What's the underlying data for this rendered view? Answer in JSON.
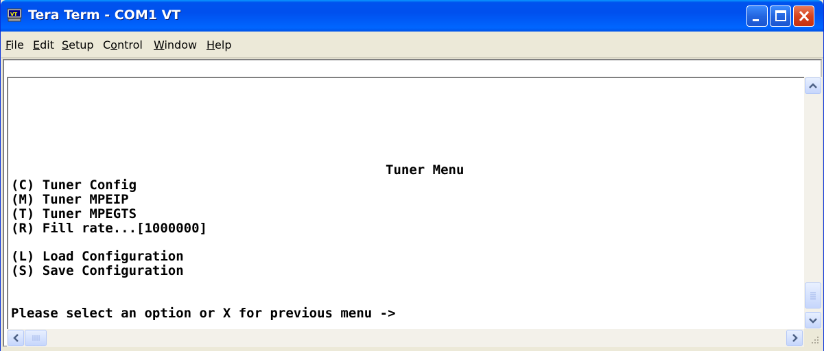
{
  "window": {
    "title": "Tera Term - COM1 VT",
    "icon": "tera-term-vt-icon",
    "accent_color": "#0054e3",
    "close_color": "#d6431d"
  },
  "menu": {
    "items": [
      {
        "label": "File",
        "mnemonic": "F"
      },
      {
        "label": "Edit",
        "mnemonic": "E"
      },
      {
        "label": "Setup",
        "mnemonic": "S"
      },
      {
        "label": "Control",
        "mnemonic": "o"
      },
      {
        "label": "Window",
        "mnemonic": "W"
      },
      {
        "label": "Help",
        "mnemonic": "H"
      }
    ]
  },
  "terminal": {
    "heading": "Tuner Menu",
    "options": [
      "(C) Tuner Config",
      "(M) Tuner MPEIP",
      "(T) Tuner MPEGTS",
      "(R) Fill rate...[1000000]",
      "(L) Load Configuration",
      "(S) Save Configuration"
    ],
    "prompt": "Please select an option or X for previous menu ->"
  }
}
